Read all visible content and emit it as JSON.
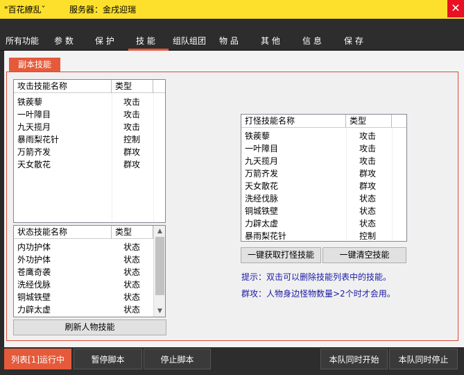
{
  "window": {
    "title": "\"百花繚乱ˇ",
    "server_label": "服务器：金戌迎瑞",
    "close_glyph": "✕"
  },
  "tabs": [
    {
      "label": "所有功能"
    },
    {
      "label": "参 数"
    },
    {
      "label": "保 护"
    },
    {
      "label": "技 能"
    },
    {
      "label": "组队组团"
    },
    {
      "label": "物 品"
    },
    {
      "label": "其 他"
    },
    {
      "label": "信 息"
    },
    {
      "label": "保 存"
    }
  ],
  "subtab": "副本技能",
  "attack_list": {
    "col_name": "攻击技能名称",
    "col_type": "类型",
    "rows": [
      {
        "name": "铁蒺藜",
        "type": "攻击"
      },
      {
        "name": "一叶障目",
        "type": "攻击"
      },
      {
        "name": "九天揽月",
        "type": "攻击"
      },
      {
        "name": "暴雨梨花针",
        "type": "控制"
      },
      {
        "name": "万箭齐发",
        "type": "群攻"
      },
      {
        "name": "天女散花",
        "type": "群攻"
      }
    ]
  },
  "state_list": {
    "col_name": "状态技能名称",
    "col_type": "类型",
    "rows": [
      {
        "name": "内功护体",
        "type": "状态"
      },
      {
        "name": "外功护体",
        "type": "状态"
      },
      {
        "name": "苍鹰奇袭",
        "type": "状态"
      },
      {
        "name": "洗经伐脉",
        "type": "状态"
      },
      {
        "name": "铜城铁壁",
        "type": "状态"
      },
      {
        "name": "力辟太虚",
        "type": "状态"
      }
    ]
  },
  "monster_list": {
    "col_name": "打怪技能名称",
    "col_type": "类型",
    "rows": [
      {
        "name": "铁蒺藜",
        "type": "攻击"
      },
      {
        "name": "一叶障目",
        "type": "攻击"
      },
      {
        "name": "九天揽月",
        "type": "攻击"
      },
      {
        "name": "万箭齐发",
        "type": "群攻"
      },
      {
        "name": "天女散花",
        "type": "群攻"
      },
      {
        "name": "洗经伐脉",
        "type": "状态"
      },
      {
        "name": "铜城铁壁",
        "type": "状态"
      },
      {
        "name": "力辟太虚",
        "type": "状态"
      },
      {
        "name": "暴雨梨花针",
        "type": "控制"
      }
    ]
  },
  "buttons": {
    "refresh": "刷新人物技能",
    "get_skills": "一键获取打怪技能",
    "clear_skills": "一键清空技能"
  },
  "hints": {
    "hint1": "提示：双击可以删除技能列表中的技能。",
    "hint2": "群攻：人物身边怪物数量>2个时才会用。"
  },
  "bottom": {
    "running": "列表[1]运行中",
    "pause": "暂停脚本",
    "stop": "停止脚本",
    "team_start": "本队同时开始",
    "team_stop": "本队同时停止"
  },
  "colors": {
    "accent": "#e55a3a",
    "titlebar": "#fce02c",
    "hint": "#1a1aa8"
  }
}
